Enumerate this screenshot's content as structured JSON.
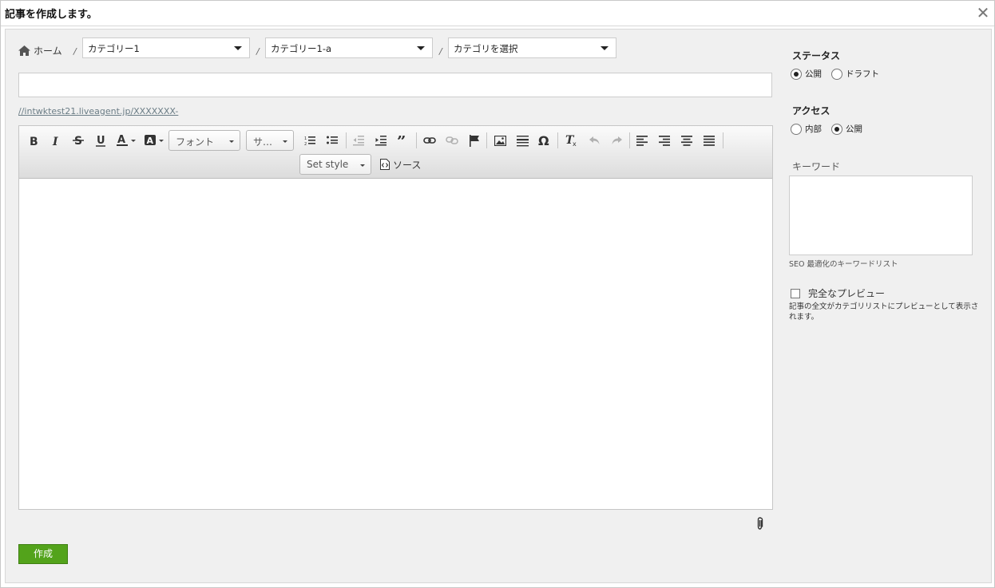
{
  "dialog": {
    "title": "記事を作成します。",
    "close_glyph": "✕"
  },
  "breadcrumb": {
    "home_label": "ホーム",
    "separator": "/",
    "category1": "カテゴリー1",
    "category2": "カテゴリー1-a",
    "category3": "カテゴリを選択"
  },
  "article": {
    "title_value": "",
    "url_text": "//intwktest21.liveagent.jp/XXXXXXX-"
  },
  "toolbar": {
    "font_combo": "フォント",
    "size_combo": "サ…",
    "style_combo": "Set style",
    "source_label": "ソース",
    "buttons": [
      "bold-icon",
      "italic-icon",
      "strikethrough-icon",
      "underline-icon",
      "text-color-icon",
      "background-color-icon",
      "numbered-list-icon",
      "bulleted-list-icon",
      "outdent-icon",
      "indent-icon",
      "blockquote-icon",
      "link-icon",
      "unlink-icon",
      "anchor-flag-icon",
      "image-icon",
      "horizontal-rule-icon",
      "special-char-icon",
      "remove-format-icon",
      "undo-icon",
      "redo-icon",
      "align-left-icon",
      "align-right-icon",
      "align-center-icon",
      "align-justify-icon"
    ]
  },
  "actions": {
    "create_label": "作成"
  },
  "sidebar": {
    "status_heading": "ステータス",
    "status_public": "公開",
    "status_draft": "ドラフト",
    "status_selected": "公開",
    "access_heading": "アクセス",
    "access_internal": "内部",
    "access_public": "公開",
    "access_selected": "公開",
    "keywords_label": "キーワード",
    "keywords_value": "",
    "keywords_hint": "SEO 最適化のキーワードリスト",
    "full_preview_label": "完全なプレビュー",
    "full_preview_checked": false,
    "full_preview_desc": "記事の全文がカテゴリリストにプレビューとして表示されます。"
  },
  "colors": {
    "create_button": "#53a31b",
    "panel_background": "#f0f0f0"
  }
}
